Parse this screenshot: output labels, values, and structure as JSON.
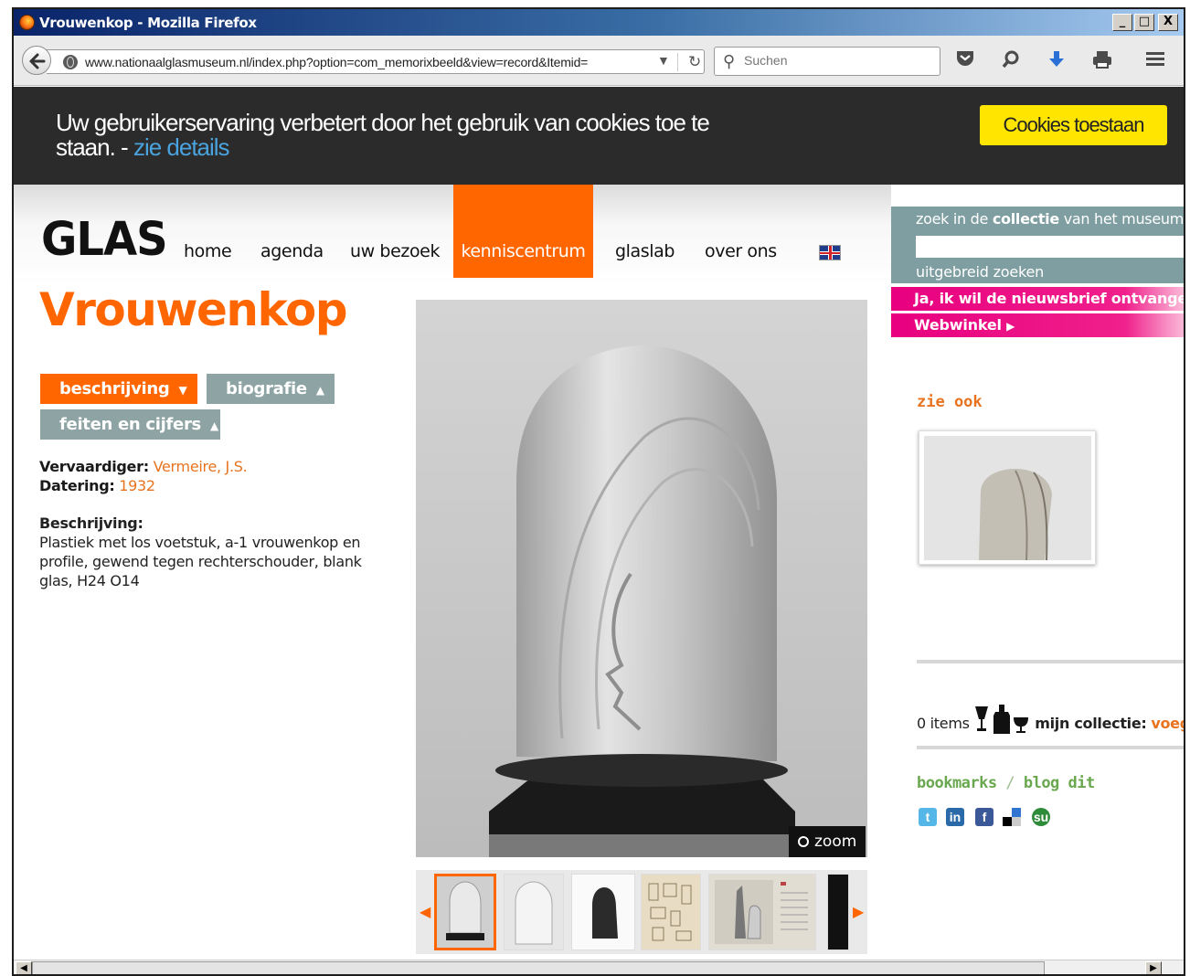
{
  "window": {
    "title": "Vrouwenkop - Mozilla Firefox",
    "minimize": "_",
    "maximize": "□",
    "close": "X"
  },
  "toolbar": {
    "url": "www.nationaalglasmuseum.nl/index.php?option=com_memorixbeeld&view=record&Itemid=",
    "search_placeholder": "Suchen"
  },
  "cookie": {
    "message": "Uw gebruikerservaring verbetert door het gebruik van cookies toe te staan. - ",
    "details_link": "zie details",
    "accept_button": "Cookies toestaan"
  },
  "site": {
    "logo": "GLAS",
    "nav": [
      "home",
      "agenda",
      "uw bezoek",
      "kenniscentrum",
      "glaslab",
      "over ons"
    ],
    "active_nav": "kenniscentrum"
  },
  "record": {
    "title": "Vrouwenkop",
    "tabs": [
      "beschrijving",
      "biografie",
      "feiten en cijfers"
    ],
    "maker_label": "Vervaardiger:",
    "maker_value": "Vermeire, J.S.",
    "date_label": "Datering:",
    "date_value": "1932",
    "description_label": "Beschrijving:",
    "description_text": "Plastiek met los voetstuk, a-1 vrouwenkop en profile, gewend tegen rechterschouder, blank glas, H24 O14",
    "zoom_label": "zoom"
  },
  "sidebar": {
    "search_label_pre": "zoek in de ",
    "search_label_bold": "collectie",
    "search_label_post": " van het museum",
    "advanced_search": "uitgebreid zoeken",
    "newsletter": "Ja, ik wil de nieuwsbrief ontvangen",
    "webshop": "Webwinkel",
    "see_also": "zie ook",
    "items_count": "0 items",
    "my_collection_label": "mijn collectie:",
    "my_collection_action": "voeg toe",
    "bookmarks": "bookmarks",
    "bookmarks_sep": " / ",
    "blog": "blog dit"
  },
  "colors": {
    "accent_orange": "#ff6600",
    "tab_grey": "#8ea3a3",
    "pink": "#e8007f",
    "green": "#6aa84f"
  }
}
